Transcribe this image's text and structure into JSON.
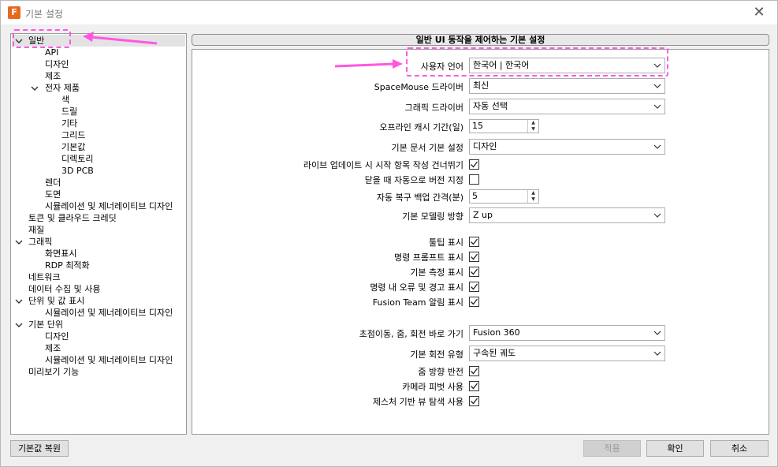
{
  "window": {
    "title": "기본 설정",
    "app_icon": "F",
    "close_glyph": "✕"
  },
  "tree": {
    "items": [
      {
        "label": "일반",
        "chevron": true
      },
      {
        "label": "API"
      },
      {
        "label": "디자인"
      },
      {
        "label": "제조"
      },
      {
        "label": "전자 제품",
        "chevron": true
      },
      {
        "label": "색"
      },
      {
        "label": "드릴"
      },
      {
        "label": "기타"
      },
      {
        "label": "그리드"
      },
      {
        "label": "기본값"
      },
      {
        "label": "디렉토리"
      },
      {
        "label": "3D PCB"
      },
      {
        "label": "렌더"
      },
      {
        "label": "도면"
      },
      {
        "label": "시뮬레이션 및 제너레이티브 디자인"
      },
      {
        "label": "토큰 및 클라우드 크레딧"
      },
      {
        "label": "재질"
      },
      {
        "label": "그래픽",
        "chevron": true
      },
      {
        "label": "화면표시"
      },
      {
        "label": "RDP 최적화"
      },
      {
        "label": "네트워크"
      },
      {
        "label": "데이터 수집 및 사용"
      },
      {
        "label": "단위 및 값 표시",
        "chevron": true
      },
      {
        "label": "시뮬레이션 및 제너레이티브 디자인"
      },
      {
        "label": "기본 단위",
        "chevron": true
      },
      {
        "label": "디자인"
      },
      {
        "label": "제조"
      },
      {
        "label": "시뮬레이션 및 제너레이티브 디자인"
      },
      {
        "label": "미리보기 기능"
      }
    ]
  },
  "header": {
    "title": "일반 UI 동작을 제어하는 기본 설정"
  },
  "settings": {
    "user_language": {
      "label": "사용자 언어",
      "value": "한국어 | 한국어"
    },
    "spacemouse_driver": {
      "label": "SpaceMouse 드라이버",
      "value": "최신"
    },
    "graphics_driver": {
      "label": "그래픽 드라이버",
      "value": "자동 선택"
    },
    "offline_cache": {
      "label": "오프라인 캐시 기간(일)",
      "value": "15"
    },
    "default_doc": {
      "label": "기본 문서 기본 설정",
      "value": "디자인"
    },
    "skip_startup": {
      "label": "라이브 업데이트 시 시작 항목 작성 건너뛰기",
      "checked": true
    },
    "auto_version": {
      "label": "닫을 때 자동으로 버전 지정",
      "checked": false
    },
    "autorecovery": {
      "label": "자동 복구 백업 간격(분)",
      "value": "5"
    },
    "modeling_orientation": {
      "label": "기본 모델링 방향",
      "value": "Z up"
    },
    "tooltips": {
      "label": "툴팁 표시",
      "checked": true
    },
    "command_prompts": {
      "label": "명령 프롬프트 표시",
      "checked": true
    },
    "default_measure": {
      "label": "기본 측정 표시",
      "checked": true
    },
    "command_errors": {
      "label": "명령 내 오류 및 경고 표시",
      "checked": true
    },
    "team_notifications": {
      "label": "Fusion Team 알림 표시",
      "checked": true
    },
    "pan_zoom_orbit": {
      "label": "초점이동, 줌, 회전 바로 가기",
      "value": "Fusion 360"
    },
    "orbit_type": {
      "label": "기본 회전 유형",
      "value": "구속된 궤도"
    },
    "reverse_zoom": {
      "label": "줌 방향 반전",
      "checked": true
    },
    "camera_pivot": {
      "label": "카메라 피벗 사용",
      "checked": true
    },
    "gesture_nav": {
      "label": "제스처 기반 뷰 탐색 사용",
      "checked": true
    }
  },
  "buttons": {
    "restore": "기본값 복원",
    "apply": "적용",
    "ok": "확인",
    "cancel": "취소"
  },
  "colors": {
    "annotation": "#ff58e0"
  }
}
